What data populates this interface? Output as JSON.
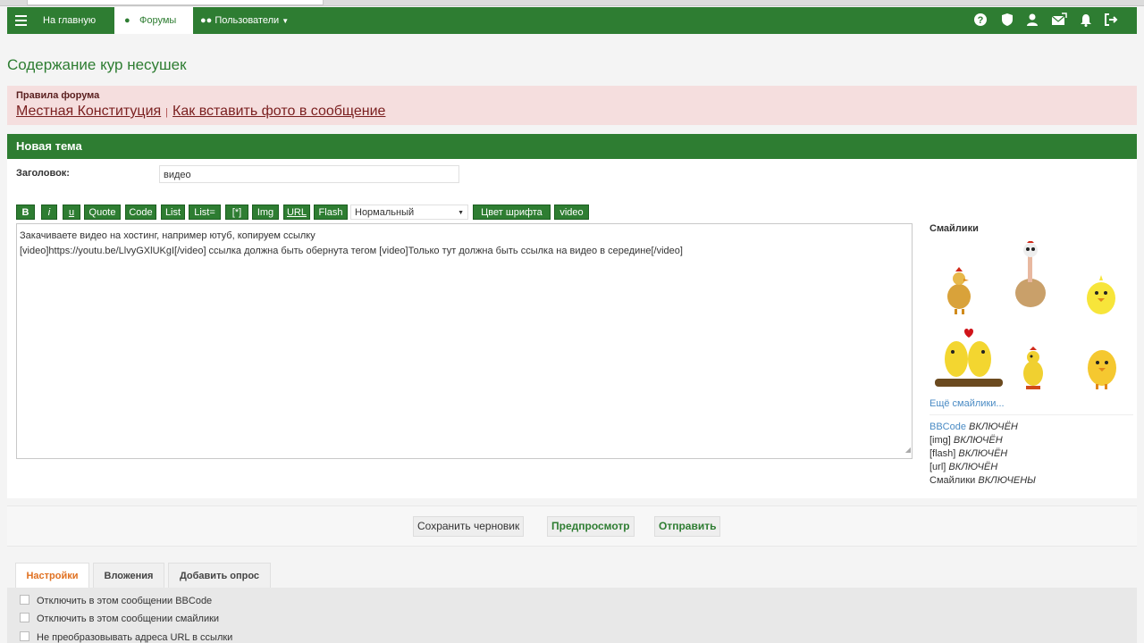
{
  "navbar": {
    "home": "На главную",
    "forums": "Форумы",
    "users": "Пользователи"
  },
  "page": {
    "title": "Содержание кур несушек"
  },
  "rules": {
    "heading": "Правила форума",
    "link1": "Местная Конституция",
    "separator": "|",
    "link2": "Как вставить фото в сообщение"
  },
  "section": {
    "title": "Новая тема"
  },
  "form": {
    "subject_label": "Заголовок:",
    "subject_value": "видео"
  },
  "toolbar": {
    "buttons": [
      "B",
      "i",
      "u",
      "Quote",
      "Code",
      "List",
      "List=",
      "[*]",
      "Img",
      "URL",
      "Flash"
    ],
    "font_size": "Нормальный",
    "font_color": "Цвет шрифта",
    "video": "video"
  },
  "editor": {
    "line1": "Закачиваете видео на хостинг, например ютуб, копируем ссылку",
    "line2": "",
    "line3": "[video]https://youtu.be/LlvyGXlUKgI[/video] ссылка должна быть обернута тегом [video]Только тут должна быть ссылка на видео в середине[/video]"
  },
  "smilies": {
    "title": "Смайлики",
    "more": "Ещё смайлики..."
  },
  "status": [
    {
      "key": "BBCode",
      "value": "ВКЛЮЧЁН"
    },
    {
      "key": "[img]",
      "value": "ВКЛЮЧЁН"
    },
    {
      "key": "[flash]",
      "value": "ВКЛЮЧЁН"
    },
    {
      "key": "[url]",
      "value": "ВКЛЮЧЁН"
    },
    {
      "key": "Смайлики",
      "value": "ВКЛЮЧЕНЫ"
    }
  ],
  "actions": {
    "save_draft": "Сохранить черновик",
    "preview": "Предпросмотр",
    "submit": "Отправить"
  },
  "tabs": [
    "Настройки",
    "Вложения",
    "Добавить опрос"
  ],
  "options": [
    "Отключить в этом сообщении BBCode",
    "Отключить в этом сообщении смайлики",
    "Не преобразовывать адреса URL в ссылки"
  ],
  "colors": {
    "primary": "#2e7d32",
    "rules_bg": "#f5dede",
    "link": "#4a8bc4",
    "active_tab": "#e07020"
  }
}
